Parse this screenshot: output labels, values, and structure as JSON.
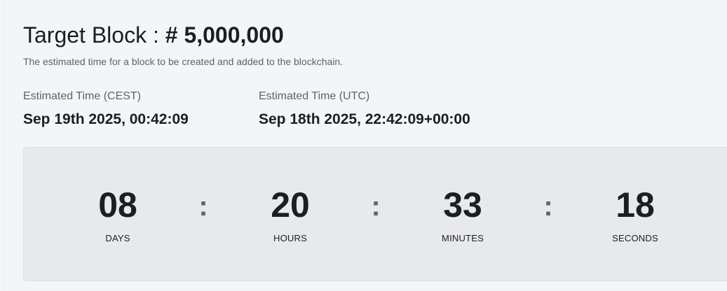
{
  "header": {
    "title_prefix": "Target Block : ",
    "title_number": "# 5,000,000",
    "subtitle": "The estimated time for a block to be created and added to the blockchain."
  },
  "estimates": {
    "cest": {
      "label": "Estimated Time (CEST)",
      "value": "Sep 19th 2025, 00:42:09"
    },
    "utc": {
      "label": "Estimated Time (UTC)",
      "value": "Sep 18th 2025, 22:42:09+00:00"
    }
  },
  "countdown": {
    "separator": ":",
    "days": {
      "value": "08",
      "label": "DAYS"
    },
    "hours": {
      "value": "20",
      "label": "HOURS"
    },
    "minutes": {
      "value": "33",
      "label": "MINUTES"
    },
    "seconds": {
      "value": "18",
      "label": "SECONDS"
    }
  }
}
